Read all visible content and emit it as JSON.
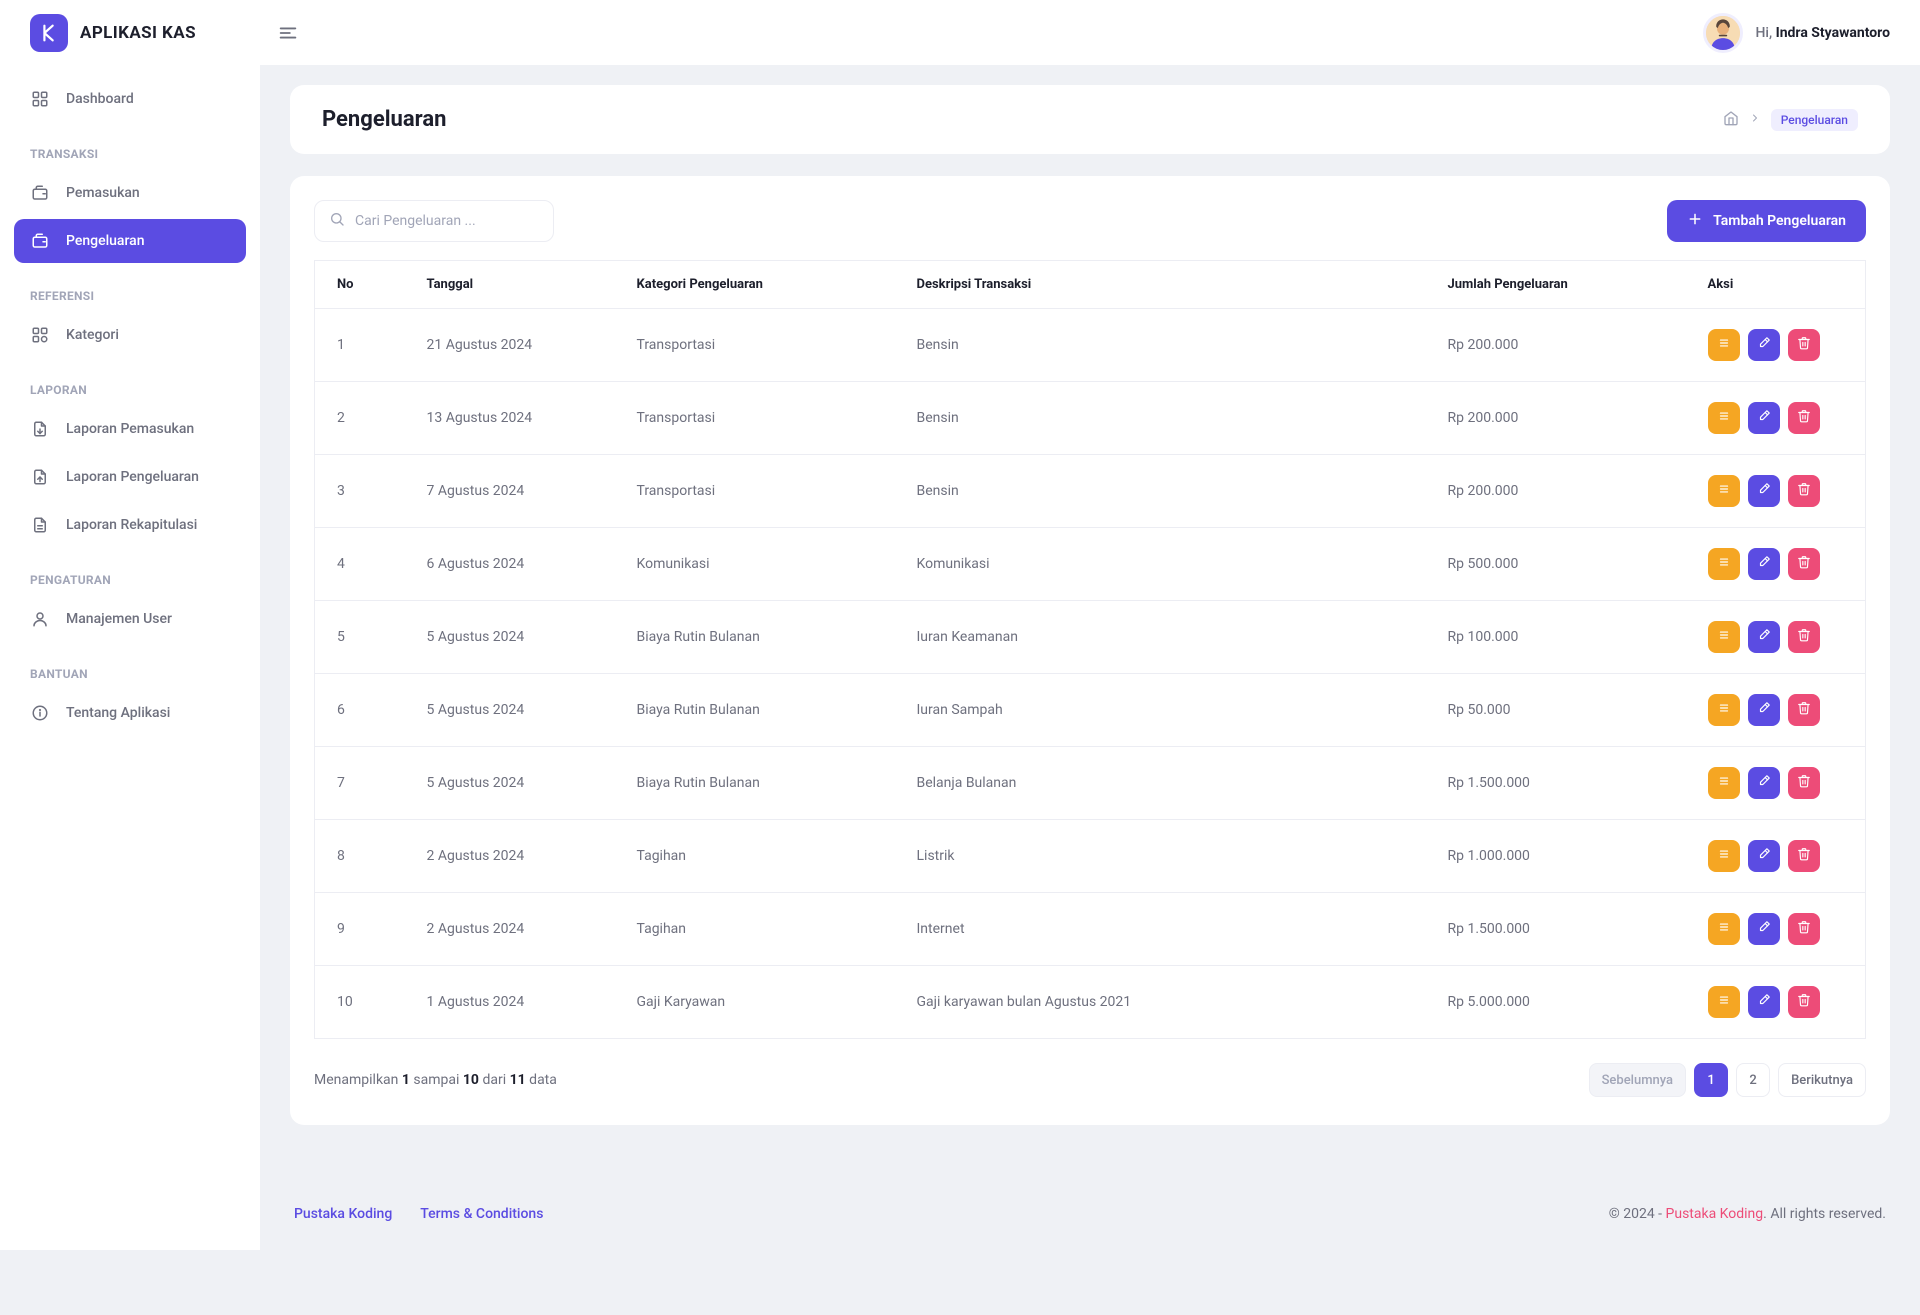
{
  "app": {
    "name": "APLIKASI KAS"
  },
  "user": {
    "greeting": "Hi,",
    "name": "Indra Styawantoro"
  },
  "sidebar": {
    "dashboard": "Dashboard",
    "sections": {
      "transaksi": "TRANSAKSI",
      "referensi": "REFERENSI",
      "laporan": "LAPORAN",
      "pengaturan": "PENGATURAN",
      "bantuan": "BANTUAN"
    },
    "items": {
      "pemasukan": "Pemasukan",
      "pengeluaran": "Pengeluaran",
      "kategori": "Kategori",
      "laporan_pemasukan": "Laporan Pemasukan",
      "laporan_pengeluaran": "Laporan Pengeluaran",
      "laporan_rekapitulasi": "Laporan Rekapitulasi",
      "manajemen_user": "Manajemen User",
      "tentang": "Tentang Aplikasi"
    }
  },
  "page": {
    "title": "Pengeluaran",
    "breadcrumb_current": "Pengeluaran"
  },
  "toolbar": {
    "search_placeholder": "Cari Pengeluaran ...",
    "add_label": "Tambah Pengeluaran"
  },
  "table": {
    "columns": {
      "no": "No",
      "tanggal": "Tanggal",
      "kategori": "Kategori Pengeluaran",
      "deskripsi": "Deskripsi Transaksi",
      "jumlah": "Jumlah Pengeluaran",
      "aksi": "Aksi"
    },
    "rows": [
      {
        "no": "1",
        "tanggal": "21 Agustus 2024",
        "kategori": "Transportasi",
        "deskripsi": "Bensin",
        "jumlah": "Rp 200.000"
      },
      {
        "no": "2",
        "tanggal": "13 Agustus 2024",
        "kategori": "Transportasi",
        "deskripsi": "Bensin",
        "jumlah": "Rp 200.000"
      },
      {
        "no": "3",
        "tanggal": "7 Agustus 2024",
        "kategori": "Transportasi",
        "deskripsi": "Bensin",
        "jumlah": "Rp 200.000"
      },
      {
        "no": "4",
        "tanggal": "6 Agustus 2024",
        "kategori": "Komunikasi",
        "deskripsi": "Komunikasi",
        "jumlah": "Rp 500.000"
      },
      {
        "no": "5",
        "tanggal": "5 Agustus 2024",
        "kategori": "Biaya Rutin Bulanan",
        "deskripsi": "Iuran Keamanan",
        "jumlah": "Rp 100.000"
      },
      {
        "no": "6",
        "tanggal": "5 Agustus 2024",
        "kategori": "Biaya Rutin Bulanan",
        "deskripsi": "Iuran Sampah",
        "jumlah": "Rp 50.000"
      },
      {
        "no": "7",
        "tanggal": "5 Agustus 2024",
        "kategori": "Biaya Rutin Bulanan",
        "deskripsi": "Belanja Bulanan",
        "jumlah": "Rp 1.500.000"
      },
      {
        "no": "8",
        "tanggal": "2 Agustus 2024",
        "kategori": "Tagihan",
        "deskripsi": "Listrik",
        "jumlah": "Rp 1.000.000"
      },
      {
        "no": "9",
        "tanggal": "2 Agustus 2024",
        "kategori": "Tagihan",
        "deskripsi": "Internet",
        "jumlah": "Rp 1.500.000"
      },
      {
        "no": "10",
        "tanggal": "1 Agustus 2024",
        "kategori": "Gaji Karyawan",
        "deskripsi": "Gaji karyawan bulan Agustus 2021",
        "jumlah": "Rp 5.000.000"
      }
    ]
  },
  "pagination": {
    "summary_prefix": "Menampilkan",
    "from": "1",
    "to_word": "sampai",
    "to": "10",
    "of_word": "dari",
    "total": "11",
    "suffix": "data",
    "prev": "Sebelumnya",
    "next": "Berikutnya",
    "pages": [
      "1",
      "2"
    ],
    "active": "1"
  },
  "footer": {
    "link1": "Pustaka Koding",
    "link2": "Terms & Conditions",
    "copyright_prefix": "© 2024 - ",
    "brand": "Pustaka Koding",
    "copyright_suffix": ". All rights reserved."
  }
}
